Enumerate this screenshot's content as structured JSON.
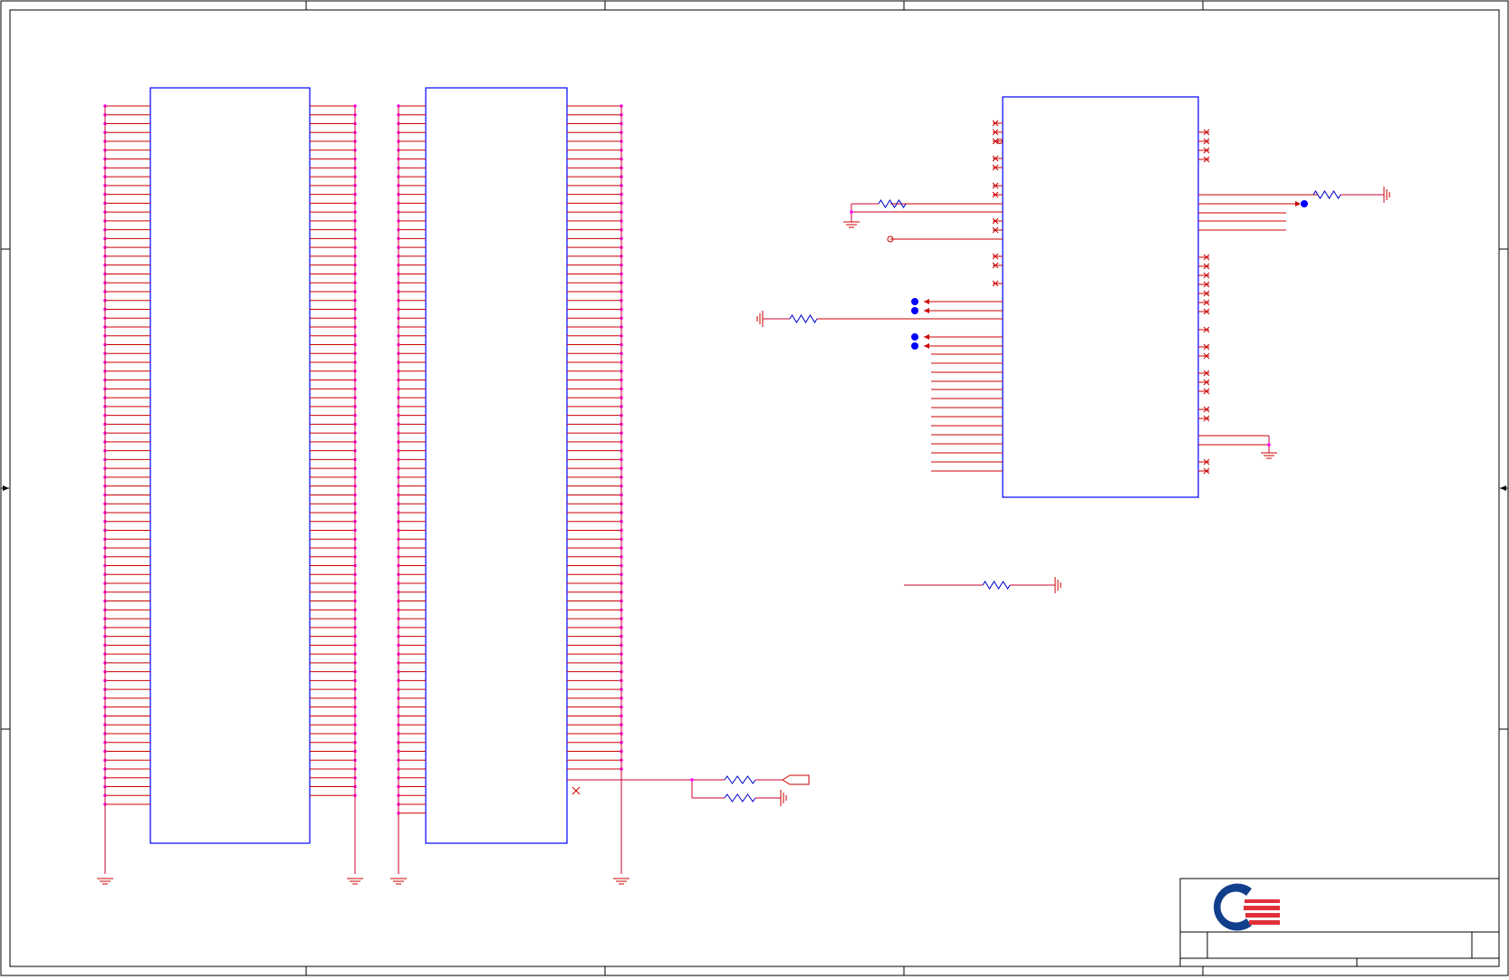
{
  "sheet": {
    "title_block_text": ""
  },
  "colors": {
    "frame": "#000000",
    "part_outline": "#0000ff",
    "wire": "#cc0000",
    "pin_dot": "#ff00ff",
    "net_wire": "#cc0033",
    "logo_blue": "#123f8c",
    "logo_red": "#e0303a",
    "port_blue": "#0000ff"
  },
  "icons": {
    "ground": "ground-symbol-icon",
    "resistor": "resistor-icon",
    "no_connect": "no-connect-x-icon",
    "logo": "company-logo-icon"
  }
}
